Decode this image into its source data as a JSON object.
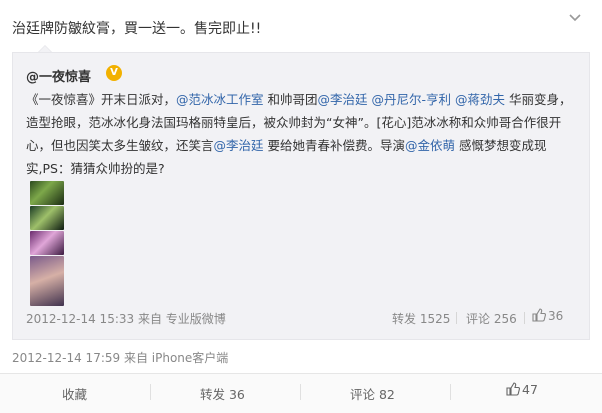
{
  "post": {
    "text": "治廷牌防皺紋膏，買一送一。售完即止!!",
    "meta": "2012-12-14 17:59 来自 iPhone客户端"
  },
  "quoted": {
    "author": "@一夜惊喜",
    "body": [
      {
        "t": "《一夜惊喜》开末日派对，",
        "m": false
      },
      {
        "t": "@范冰冰工作室",
        "m": true
      },
      {
        "t": " 和帅哥团",
        "m": false
      },
      {
        "t": "@李治廷",
        "m": true
      },
      {
        "t": " ",
        "m": false
      },
      {
        "t": "@丹尼尔-亨利",
        "m": true
      },
      {
        "t": " ",
        "m": false
      },
      {
        "t": "@蒋劲夫",
        "m": true
      },
      {
        "t": " 华丽变身，造型抢眼，范冰冰化身法国玛格丽特皇后，被众帅封为“女神”。[花心]范冰冰称和众帅哥合作很开心，但也因笑太多生皱纹，还笑言",
        "m": false
      },
      {
        "t": "@李治廷",
        "m": true
      },
      {
        "t": " 要给她青春补偿费。导演",
        "m": false
      },
      {
        "t": "@金依萌",
        "m": true
      },
      {
        "t": " 感慨梦想变成现实,PS：猜猜众帅扮的是?",
        "m": false
      }
    ],
    "meta": "2012-12-14 15:33 来自 专业版微博",
    "repost": "转发 1525",
    "comment": "评论 256",
    "like": "36"
  },
  "actions": {
    "favorite": "收藏",
    "repost": "转发 36",
    "comment": "评论 82",
    "like": "47"
  },
  "icons": {
    "collapse": "chevron-down-icon",
    "verified": "verified-badge-icon",
    "like": "thumb-up-icon"
  },
  "colors": {
    "mention": "#3366aa",
    "verified": "#f2b100"
  }
}
